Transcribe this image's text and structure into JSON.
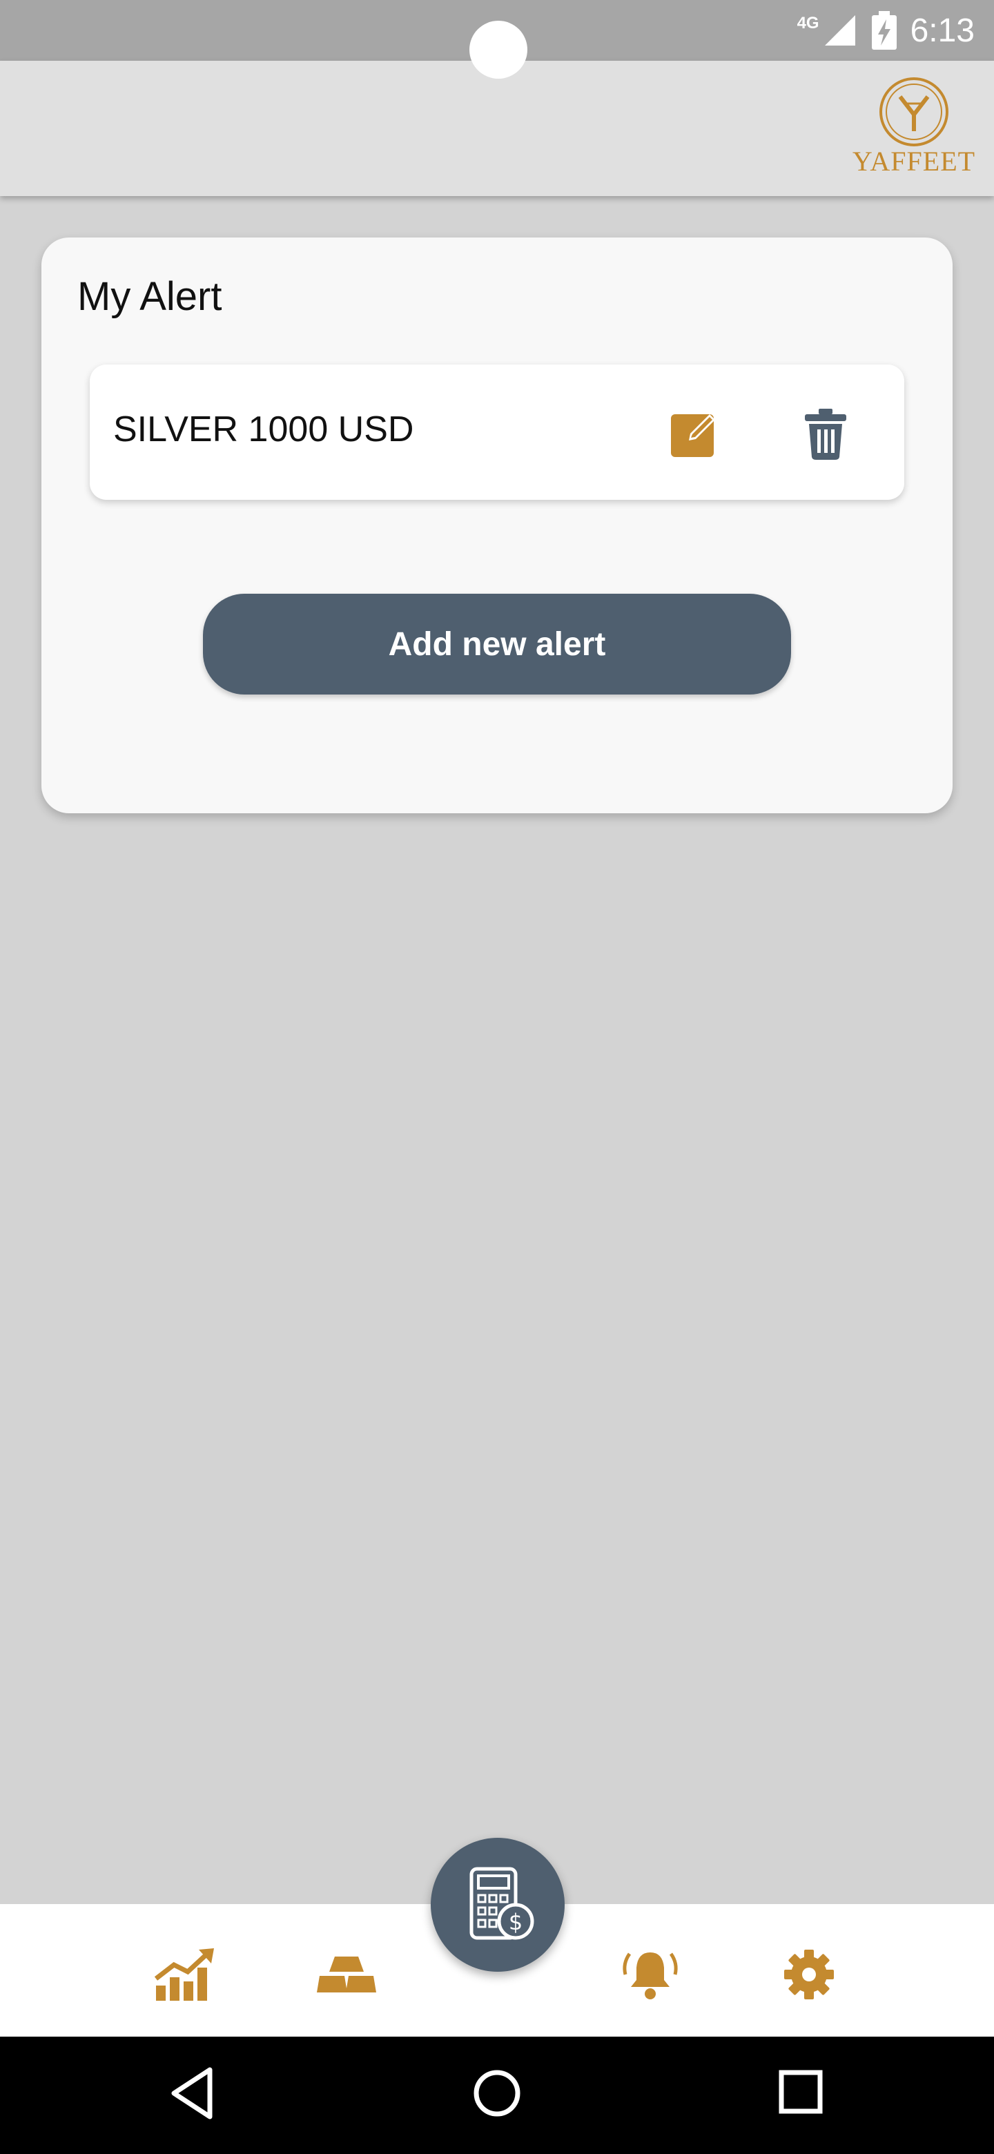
{
  "status_bar": {
    "network": "4G",
    "time": "6:13"
  },
  "app_bar": {
    "brand": "YAFFEET"
  },
  "alerts": {
    "title": "My Alert",
    "items": [
      {
        "label": "SILVER 1000 USD"
      }
    ],
    "add_button_label": "Add new alert"
  },
  "bottom_nav": {
    "items": [
      {
        "icon": "chart-up-icon"
      },
      {
        "icon": "gold-bars-icon"
      },
      {
        "icon": "calculator-dollar-icon"
      },
      {
        "icon": "bell-ringing-icon"
      },
      {
        "icon": "gear-icon"
      }
    ]
  },
  "colors": {
    "accent": "#c48a2f",
    "primary": "#4f5f6f",
    "background": "#d3d3d3"
  }
}
